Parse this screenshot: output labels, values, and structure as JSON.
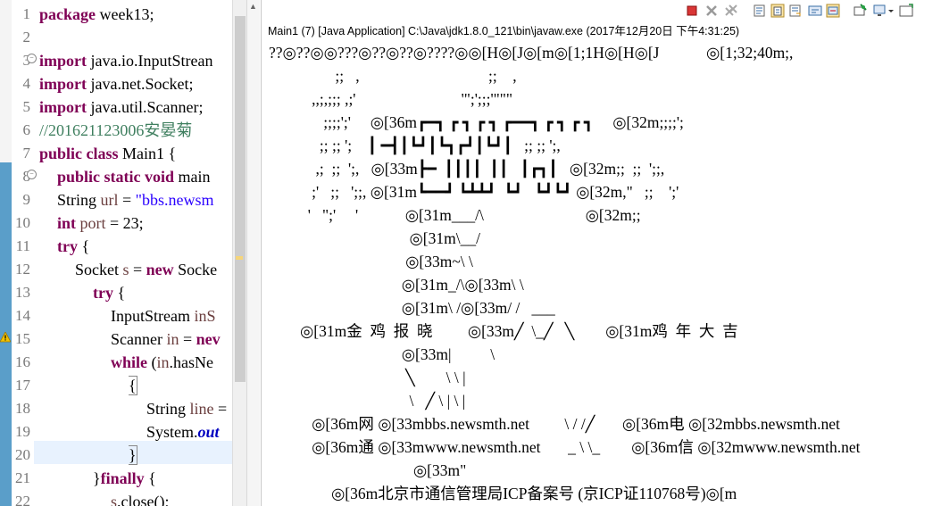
{
  "editor": {
    "line_numbers": [
      "1",
      "2",
      "3",
      "4",
      "5",
      "6",
      "7",
      "8",
      "9",
      "10",
      "11",
      "12",
      "13",
      "14",
      "15",
      "16",
      "17",
      "18",
      "19",
      "20",
      "21",
      "22"
    ],
    "l1_kw": "package",
    "l1_rest": " week13;",
    "l3_kw": "import",
    "l3_rest": " java.io.InputStrean",
    "l4_kw": "import",
    "l4_rest": " java.net.Socket;",
    "l5_kw": "import",
    "l5_rest": " java.util.Scanner;",
    "l6_comment": "//201621123006安晏菊",
    "l7_kw": "public class",
    "l7_rest": " Main1 {",
    "l8_kw": "public static void",
    "l8_rest": " main",
    "l9_type": "String ",
    "l9_var": "url",
    "l9_eq": " = ",
    "l9_str": "\"bbs.newsm",
    "l10_kw": "int",
    "l10_var": " port",
    "l10_rest": " = 23;",
    "l11_kw": "try",
    "l11_rest": " {",
    "l12_a": "Socket ",
    "l12_var": "s",
    "l12_b": " = ",
    "l12_kw": "new",
    "l12_c": " Socke",
    "l13_kw": "try",
    "l13_rest": " {",
    "l14_a": "InputStream ",
    "l14_var": "inS",
    "l15_a": "Scanner ",
    "l15_var": "in",
    "l15_b": " = ",
    "l15_kw": "nev",
    "l16_kw": "while",
    "l16_a": " (",
    "l16_var": "in",
    "l16_b": ".hasNe",
    "l17_brace": "{",
    "l18_a": "String ",
    "l18_var": "line",
    "l18_b": " =",
    "l19_a": "System.",
    "l19_fld": "out",
    "l20_brace": "}",
    "l21_a": "}",
    "l21_kw": "finally",
    "l21_b": " {",
    "l22_var": "s",
    "l22_a": ".close();"
  },
  "console": {
    "title": "Main1 (7) [Java Application] C:\\Java\\jdk1.8.0_121\\bin\\javaw.exe (2017年12月20日 下午4:31:25)",
    "toolbar_icons": [
      "terminate-icon",
      "remove-launch-icon",
      "remove-all-icon",
      "clear-console-icon",
      "scroll-lock-icon",
      "word-wrap-icon",
      "show-on-output-icon",
      "show-on-error-icon",
      "pin-console-icon",
      "display-selected-console-icon",
      "open-console-icon"
    ],
    "lines": [
      "??◎??◎◎???◎??◎??◎????◎◎[H◎[J◎[m◎[1;1H◎[H◎[J            ◎[1;32;40m;,",
      "                 ;;   ,                                 ;;    ,",
      "           ,,;,;;; ,;'                           '\";';;;'\"\"\"",
      "              ;;;;';'     ◎[36m┏━┓ ┏ ┓ ┏ ┓ ┏━━┓ ┏ ┓ ┏ ┓     ◎[32m;;;;';",
      "             ;; ;; ';    ┃ ━┫┃┗┛┃┗┓┏┛┃┗┛┃   ;; ;; ';,",
      "            ,;  ;;  ';,   ◎[33m┣━  ┃┃┃┃  ┃┃   ┃┏┓┃   ◎[32m;;  ;;  ';;,",
      "           ;'   ;;   ';;, ◎[31m┗━━┛ ┗┻┻┛  ┗┛   ┗┛┗┛ ◎[32m,\"   ;;    ';'",
      "          '   \";'     '            ◎[31m___/\\                          ◎[32m;;",
      "                                    ◎[31m\\__/",
      "                                   ◎[33m~\\ \\",
      "                                  ◎[31m_/\\◎[33m\\ \\",
      "                                  ◎[31m\\ /◎[33m/ /   ___",
      "        ◎[31m金  鸡  报  晓         ◎[33m╱  \\_╱   ╲        ◎[31m鸡  年  大  吉",
      "                                  ◎[33m|          \\",
      "                                   ╲        \\ \\ |",
      "                                    \\   ╱ \\ | \\ |",
      "           ◎[36m网 ◎[33mbbs.newsmth.net         \\ / /╱       ◎[36m电 ◎[32mbbs.newsmth.net",
      "           ◎[36m通 ◎[33mwww.newsmth.net       _ \\ \\_        ◎[36m信 ◎[32mwww.newsmth.net",
      "                                     ◎[33m\"",
      "                ◎[36m北京市通信管理局ICP备案号 (京ICP证110768号)◎[m"
    ]
  }
}
